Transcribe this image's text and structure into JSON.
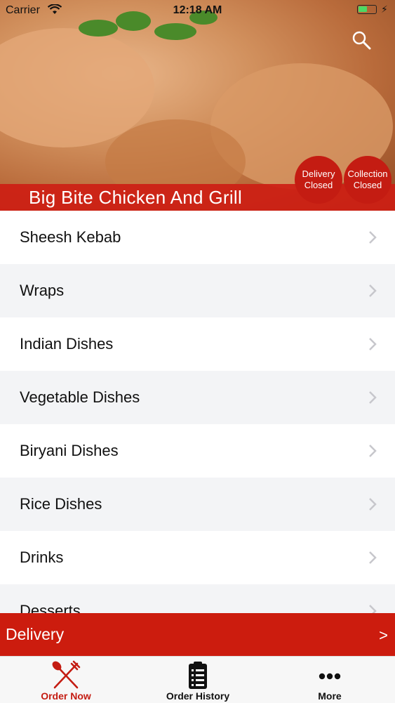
{
  "status_bar": {
    "carrier": "Carrier",
    "time": "12:18 AM"
  },
  "restaurant": {
    "name": "Big Bite Chicken And Grill"
  },
  "badges": {
    "delivery": {
      "line1": "Delivery",
      "line2": "Closed"
    },
    "collection": {
      "line1": "Collection",
      "line2": "Closed"
    }
  },
  "menu": {
    "items": [
      {
        "label": "Sheesh Kebab"
      },
      {
        "label": "Wraps"
      },
      {
        "label": "Indian Dishes"
      },
      {
        "label": "Vegetable Dishes"
      },
      {
        "label": "Biryani Dishes"
      },
      {
        "label": "Rice Dishes"
      },
      {
        "label": "Drinks"
      },
      {
        "label": "Desserts"
      }
    ]
  },
  "delivery_bar": {
    "label": "Delivery",
    "arrow": ">"
  },
  "tabs": [
    {
      "label": "Order Now",
      "icon": "fork-knife-icon",
      "active": true
    },
    {
      "label": "Order History",
      "icon": "clipboard-icon",
      "active": false
    },
    {
      "label": "More",
      "icon": "more-dots-icon",
      "active": false
    }
  ],
  "colors": {
    "accent": "#cc1c0e",
    "active_tab": "#c41c12",
    "row_alt": "#f3f4f6"
  }
}
